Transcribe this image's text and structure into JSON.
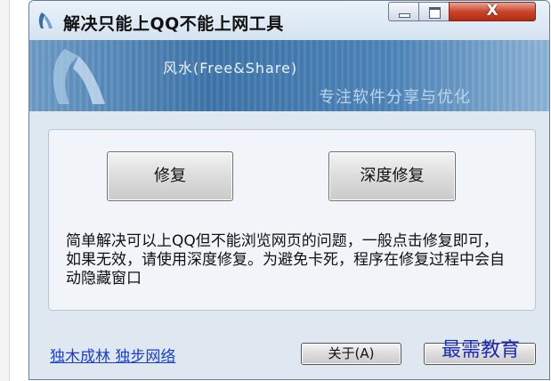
{
  "window": {
    "title": "解决只能上QQ不能上网工具",
    "controls": {
      "close_glyph": "X"
    }
  },
  "banner": {
    "brand": "风水(Free&Share)",
    "slogan": "专注软件分享与优化"
  },
  "main": {
    "repair_label": "修复",
    "deep_repair_label": "深度修复",
    "description": "简单解决可以上QQ但不能浏览网页的问题，一般点击修复即可，如果无效，请使用深度修复。为避免卡死，程序在修复过程中会自动隐藏窗口"
  },
  "footer": {
    "link_text": "独木成林 独步网络",
    "about_label": "关于(A)",
    "exit_label": ""
  },
  "watermark": "最需教育",
  "colors": {
    "link": "#1a3fd0",
    "banner": "#3f76ab",
    "close": "#c9462c"
  }
}
